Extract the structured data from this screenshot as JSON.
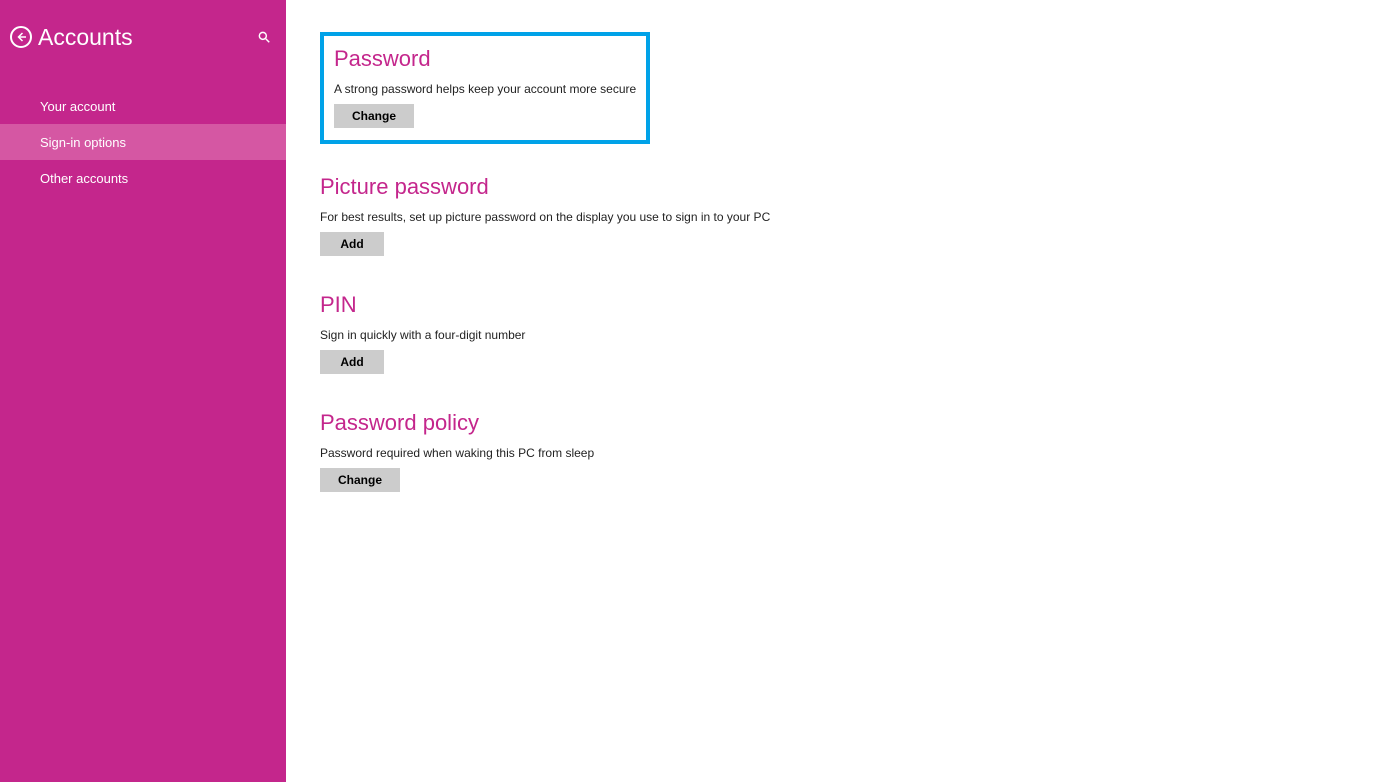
{
  "sidebar": {
    "title": "Accounts",
    "nav": [
      {
        "label": "Your account",
        "selected": false
      },
      {
        "label": "Sign-in options",
        "selected": true
      },
      {
        "label": "Other accounts",
        "selected": false
      }
    ]
  },
  "sections": {
    "password": {
      "title": "Password",
      "desc": "A strong password helps keep your account more secure",
      "button": "Change"
    },
    "picture_password": {
      "title": "Picture password",
      "desc": "For best results, set up picture password on the display you use to sign in to your PC",
      "button": "Add"
    },
    "pin": {
      "title": "PIN",
      "desc": "Sign in quickly with a four-digit number",
      "button": "Add"
    },
    "password_policy": {
      "title": "Password policy",
      "desc": "Password required when waking this PC from sleep",
      "button": "Change"
    }
  }
}
